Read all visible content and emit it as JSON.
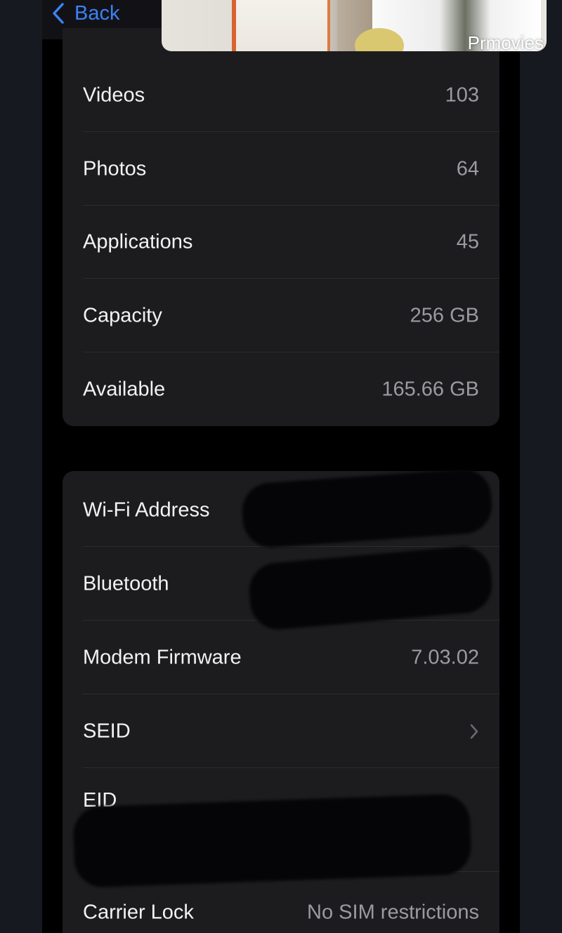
{
  "nav": {
    "back_label": "Back"
  },
  "pip_video": {
    "watermark": "Prmovies"
  },
  "storage_group": {
    "rows": [
      {
        "label": "Videos",
        "value": "103"
      },
      {
        "label": "Photos",
        "value": "64"
      },
      {
        "label": "Applications",
        "value": "45"
      },
      {
        "label": "Capacity",
        "value": "256 GB"
      },
      {
        "label": "Available",
        "value": "165.66 GB"
      }
    ]
  },
  "network_group": {
    "wifi": {
      "label": "Wi-Fi Address",
      "value": ""
    },
    "bluetooth": {
      "label": "Bluetooth",
      "value": ""
    },
    "modem": {
      "label": "Modem Firmware",
      "value": "7.03.02"
    },
    "seid": {
      "label": "SEID",
      "icon": "chevron-right-icon"
    },
    "eid": {
      "label": "EID",
      "value": ""
    },
    "carrier": {
      "label": "Carrier Lock",
      "value": "No SIM restrictions"
    }
  },
  "colors": {
    "accent": "#3b82f6",
    "group_bg": "#1c1c1f",
    "label": "#f2f2f4",
    "value": "#9a9aa0"
  }
}
